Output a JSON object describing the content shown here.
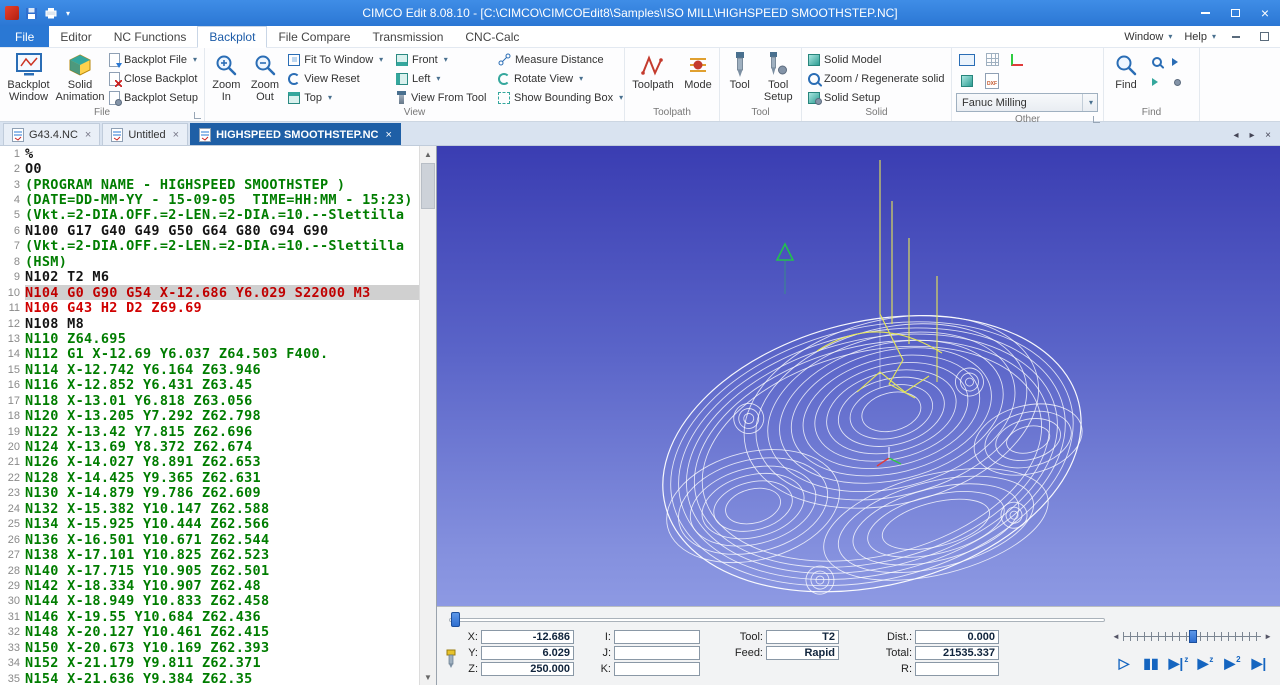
{
  "window": {
    "title": "CIMCO Edit 8.08.10 - [C:\\CIMCO\\CIMCOEdit8\\Samples\\ISO MILL\\HIGHSPEED SMOOTHSTEP.NC]",
    "controls": {
      "close": "×"
    }
  },
  "menu_tabs": [
    {
      "label": "File"
    },
    {
      "label": "Editor"
    },
    {
      "label": "NC Functions"
    },
    {
      "label": "Backplot"
    },
    {
      "label": "File Compare"
    },
    {
      "label": "Transmission"
    },
    {
      "label": "CNC-Calc"
    }
  ],
  "menu_right": {
    "window": "Window",
    "help": "Help"
  },
  "glyphs": {
    "dropdown": "▾",
    "close_tab": "×",
    "tab_prev": "◂",
    "tab_next": "▸",
    "scroll_up": "▲",
    "scroll_down": "▼",
    "ruler_left": "◄",
    "ruler_right": "►"
  },
  "ribbon": {
    "file": {
      "label": "File",
      "backplot_window": "Backplot Window",
      "solid_animation": "Solid Animation",
      "backplot_file": "Backplot File",
      "close_backplot": "Close Backplot",
      "backplot_setup": "Backplot Setup"
    },
    "view": {
      "label": "View",
      "zoom_in": "Zoom In",
      "zoom_out": "Zoom Out",
      "fit_to_window": "Fit To Window",
      "view_reset": "View Reset",
      "top": "Top",
      "front": "Front",
      "left": "Left",
      "view_from_tool": "View From Tool",
      "measure_distance": "Measure Distance",
      "rotate_view": "Rotate View",
      "show_bounding_box": "Show Bounding Box"
    },
    "toolpath": {
      "label": "Toolpath",
      "toolpath": "Toolpath",
      "mode": "Mode"
    },
    "tool": {
      "label": "Tool",
      "tool": "Tool",
      "tool_setup": "Tool Setup"
    },
    "solid": {
      "label": "Solid",
      "solid_model": "Solid Model",
      "zoom_regenerate": "Zoom / Regenerate solid",
      "solid_setup": "Solid Setup"
    },
    "other": {
      "label": "Other",
      "machine_type": "Fanuc Milling",
      "dxf_label": "DXF"
    },
    "find": {
      "label": "Find",
      "find": "Find"
    }
  },
  "doc_tabs": [
    {
      "label": "G43.4.NC"
    },
    {
      "label": "Untitled"
    },
    {
      "label": "HIGHSPEED SMOOTHSTEP.NC"
    }
  ],
  "editor": {
    "lines": [
      {
        "n": 1,
        "c": "k",
        "text": "%"
      },
      {
        "n": 2,
        "c": "k",
        "text": "O0"
      },
      {
        "n": 3,
        "c": "g",
        "text": "(PROGRAM NAME - HIGHSPEED SMOOTHSTEP )"
      },
      {
        "n": 4,
        "c": "g",
        "text": "(DATE=DD-MM-YY - 15-09-05  TIME=HH:MM - 15:23)"
      },
      {
        "n": 5,
        "c": "g",
        "text": "(Vkt.=2-DIA.OFF.=2-LEN.=2-DIA.=10.--Slettilla"
      },
      {
        "n": 6,
        "c": "k",
        "text": "N100 G17 G40 G49 G50 G64 G80 G94 G90"
      },
      {
        "n": 7,
        "c": "g",
        "text": "(Vkt.=2-DIA.OFF.=2-LEN.=2-DIA.=10.--Slettilla"
      },
      {
        "n": 8,
        "c": "g",
        "text": "(HSM)"
      },
      {
        "n": 9,
        "c": "k",
        "text": "N102 T2 M6"
      },
      {
        "n": 10,
        "c": "hl",
        "text": "N104 G0 G90 G54 X-12.686 Y6.029 S22000 M3"
      },
      {
        "n": 11,
        "c": "r",
        "text": "N106 G43 H2 D2 Z69.69"
      },
      {
        "n": 12,
        "c": "k",
        "text": "N108 M8"
      },
      {
        "n": 13,
        "c": "g",
        "text": "N110 Z64.695"
      },
      {
        "n": 14,
        "c": "g",
        "text": "N112 G1 X-12.69 Y6.037 Z64.503 F400."
      },
      {
        "n": 15,
        "c": "g",
        "text": "N114 X-12.742 Y6.164 Z63.946"
      },
      {
        "n": 16,
        "c": "g",
        "text": "N116 X-12.852 Y6.431 Z63.45"
      },
      {
        "n": 17,
        "c": "g",
        "text": "N118 X-13.01 Y6.818 Z63.056"
      },
      {
        "n": 18,
        "c": "g",
        "text": "N120 X-13.205 Y7.292 Z62.798"
      },
      {
        "n": 19,
        "c": "g",
        "text": "N122 X-13.42 Y7.815 Z62.696"
      },
      {
        "n": 20,
        "c": "g",
        "text": "N124 X-13.69 Y8.372 Z62.674"
      },
      {
        "n": 21,
        "c": "g",
        "text": "N126 X-14.027 Y8.891 Z62.653"
      },
      {
        "n": 22,
        "c": "g",
        "text": "N128 X-14.425 Y9.365 Z62.631"
      },
      {
        "n": 23,
        "c": "g",
        "text": "N130 X-14.879 Y9.786 Z62.609"
      },
      {
        "n": 24,
        "c": "g",
        "text": "N132 X-15.382 Y10.147 Z62.588"
      },
      {
        "n": 25,
        "c": "g",
        "text": "N134 X-15.925 Y10.444 Z62.566"
      },
      {
        "n": 26,
        "c": "g",
        "text": "N136 X-16.501 Y10.671 Z62.544"
      },
      {
        "n": 27,
        "c": "g",
        "text": "N138 X-17.101 Y10.825 Z62.523"
      },
      {
        "n": 28,
        "c": "g",
        "text": "N140 X-17.715 Y10.905 Z62.501"
      },
      {
        "n": 29,
        "c": "g",
        "text": "N142 X-18.334 Y10.907 Z62.48"
      },
      {
        "n": 30,
        "c": "g",
        "text": "N144 X-18.949 Y10.833 Z62.458"
      },
      {
        "n": 31,
        "c": "g",
        "text": "N146 X-19.55 Y10.684 Z62.436"
      },
      {
        "n": 32,
        "c": "g",
        "text": "N148 X-20.127 Y10.461 Z62.415"
      },
      {
        "n": 33,
        "c": "g",
        "text": "N150 X-20.673 Y10.169 Z62.393"
      },
      {
        "n": 34,
        "c": "g",
        "text": "N152 X-21.179 Y9.811 Z62.371"
      },
      {
        "n": 35,
        "c": "g",
        "text": "N154 X-21.636 Y9.384 Z62.35"
      }
    ]
  },
  "backplot": {
    "status": {
      "x_label": "X:",
      "x": "-12.686",
      "y_label": "Y:",
      "y": "6.029",
      "z_label": "Z:",
      "z": "250.000",
      "i_label": "I:",
      "i": "",
      "j_label": "J:",
      "j": "",
      "k_label": "K:",
      "k": "",
      "tool_label": "Tool:",
      "tool": "T2",
      "feed_label": "Feed:",
      "feed": "Rapid",
      "dist_label": "Dist.:",
      "dist": "0.000",
      "total_label": "Total:",
      "total": "21535.337",
      "r_label": "R:",
      "r": ""
    },
    "colors": {
      "toolpath_yellow": "#e6e655",
      "wireframe": "#ffffff",
      "accent": "#1e5fa6"
    }
  },
  "player": {
    "buttons": [
      {
        "glyph": "▷",
        "sup": ""
      },
      {
        "glyph": "▮▮",
        "sup": ""
      },
      {
        "glyph": "▶|",
        "sup": "z"
      },
      {
        "glyph": "▶",
        "sup": "z"
      },
      {
        "glyph": "▶",
        "sup": "2"
      },
      {
        "glyph": "▶|",
        "sup": ""
      }
    ]
  }
}
